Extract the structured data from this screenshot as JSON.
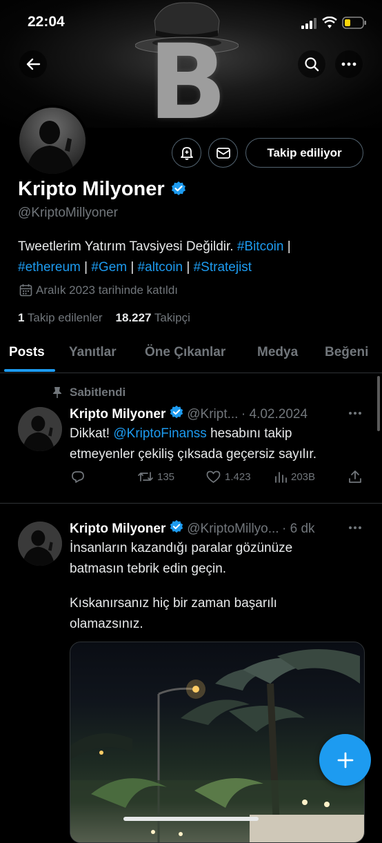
{
  "status": {
    "time": "22:04"
  },
  "profile": {
    "name": "Kripto Milyoner",
    "handle": "@KriptoMillyoner",
    "bio_text": "Tweetlerim Yatırım Tavsiyesi Değildir.",
    "bio_tag_bitcoin": "#Bitcoin",
    "bio_sep": "|",
    "bio_tag_ethereum": "#ethereum",
    "bio_tag_gem": "#Gem",
    "bio_tag_altcoin": "#altcoin",
    "bio_tag_strategist": "#Stratejist",
    "joined": "Aralık 2023 tarihinde katıldı",
    "following_count": "1",
    "following_label": "Takip edilenler",
    "followers_count": "18.227",
    "followers_label": "Takipçi",
    "follow_button": "Takip ediliyor"
  },
  "tabs": [
    "Posts",
    "Yanıtlar",
    "Öne Çıkanlar",
    "Medya",
    "Beğeni"
  ],
  "pinned_tweet": {
    "pinned_label": "Sabitlendi",
    "name": "Kripto Milyoner",
    "handle": "@Kript...",
    "date": "· 4.02.2024",
    "text_pre": "Dikkat!",
    "mention": "@KriptoFinanss",
    "text_post": "hesabını takip",
    "text_line2": "etmeyenler çekiliş çıksada geçersiz sayılır.",
    "retweets": "135",
    "likes": "1.423",
    "views": "203B"
  },
  "second_tweet": {
    "name": "Kripto Milyoner",
    "handle": "@KriptoMillyo...",
    "time": "· 6 dk",
    "line1": "İnsanların kazandığı paralar gözünüze",
    "line2": "batmasın tebrik edin geçin.",
    "line3": "Kıskanırsanız hiç bir zaman başarılı",
    "line4": "olamazsınız."
  },
  "colors": {
    "accent": "#1d9bf0",
    "background": "#000000",
    "muted": "#71767b"
  }
}
